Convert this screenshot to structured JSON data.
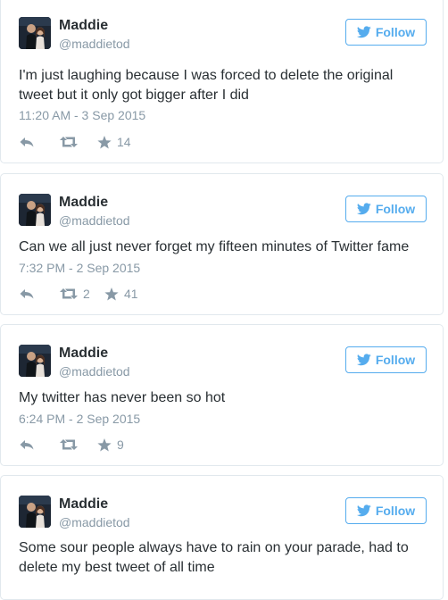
{
  "follow_label": "Follow",
  "tweets": [
    {
      "name": "Maddie",
      "handle": "@maddietod",
      "text": "I'm just laughing because I was forced to delete the original tweet but it only got bigger after I did",
      "time": "11:20 AM - 3 Sep 2015",
      "retweets": "",
      "likes": "14"
    },
    {
      "name": "Maddie",
      "handle": "@maddietod",
      "text": "Can we all just never forget my fifteen minutes of Twitter fame",
      "time": "7:32 PM - 2 Sep 2015",
      "retweets": "2",
      "likes": "41"
    },
    {
      "name": "Maddie",
      "handle": "@maddietod",
      "text": "My twitter has never been so hot",
      "time": "6:24 PM - 2 Sep 2015",
      "retweets": "",
      "likes": "9"
    },
    {
      "name": "Maddie",
      "handle": "@maddietod",
      "text": "Some sour people always have to rain on your parade, had to delete my best tweet of all time",
      "time": "",
      "retweets": "",
      "likes": ""
    }
  ],
  "colors": {
    "accent": "#55acee",
    "muted": "#8899a6",
    "text": "#292f33",
    "border": "#e1e8ed"
  }
}
